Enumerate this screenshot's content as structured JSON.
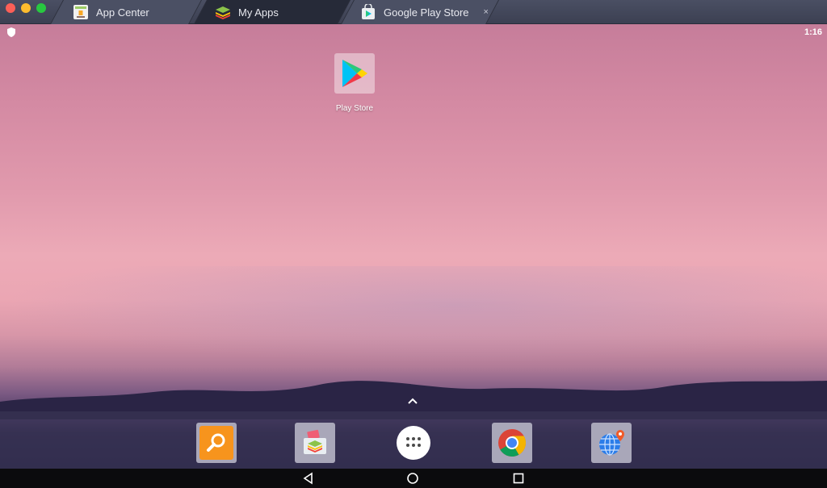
{
  "window": {
    "tabs": [
      {
        "label": "App Center",
        "icon": "app-center-icon",
        "active": false
      },
      {
        "label": "My Apps",
        "icon": "bluestacks-layers-icon",
        "active": true
      },
      {
        "label": "Google Play Store",
        "icon": "play-store-bag-icon",
        "active": false,
        "closable": true
      }
    ],
    "close_glyph": "×"
  },
  "status_bar": {
    "time": "1:16",
    "left_icon": "shield-icon"
  },
  "home_screen": {
    "apps": [
      {
        "label": "Play Store",
        "icon": "play-store-icon"
      }
    ]
  },
  "dock": {
    "items": [
      {
        "icon": "search-icon",
        "color": "#f7941d"
      },
      {
        "icon": "app-store-bag-icon",
        "color": "#a9a7b9"
      },
      {
        "icon": "app-drawer-icon",
        "color": "#ffffff"
      },
      {
        "icon": "chrome-icon",
        "color": "#a9a7b9"
      },
      {
        "icon": "globe-location-icon",
        "color": "#a9a7b9"
      }
    ]
  },
  "nav_bar": {
    "buttons": [
      "back-icon",
      "home-icon",
      "recents-icon"
    ]
  }
}
